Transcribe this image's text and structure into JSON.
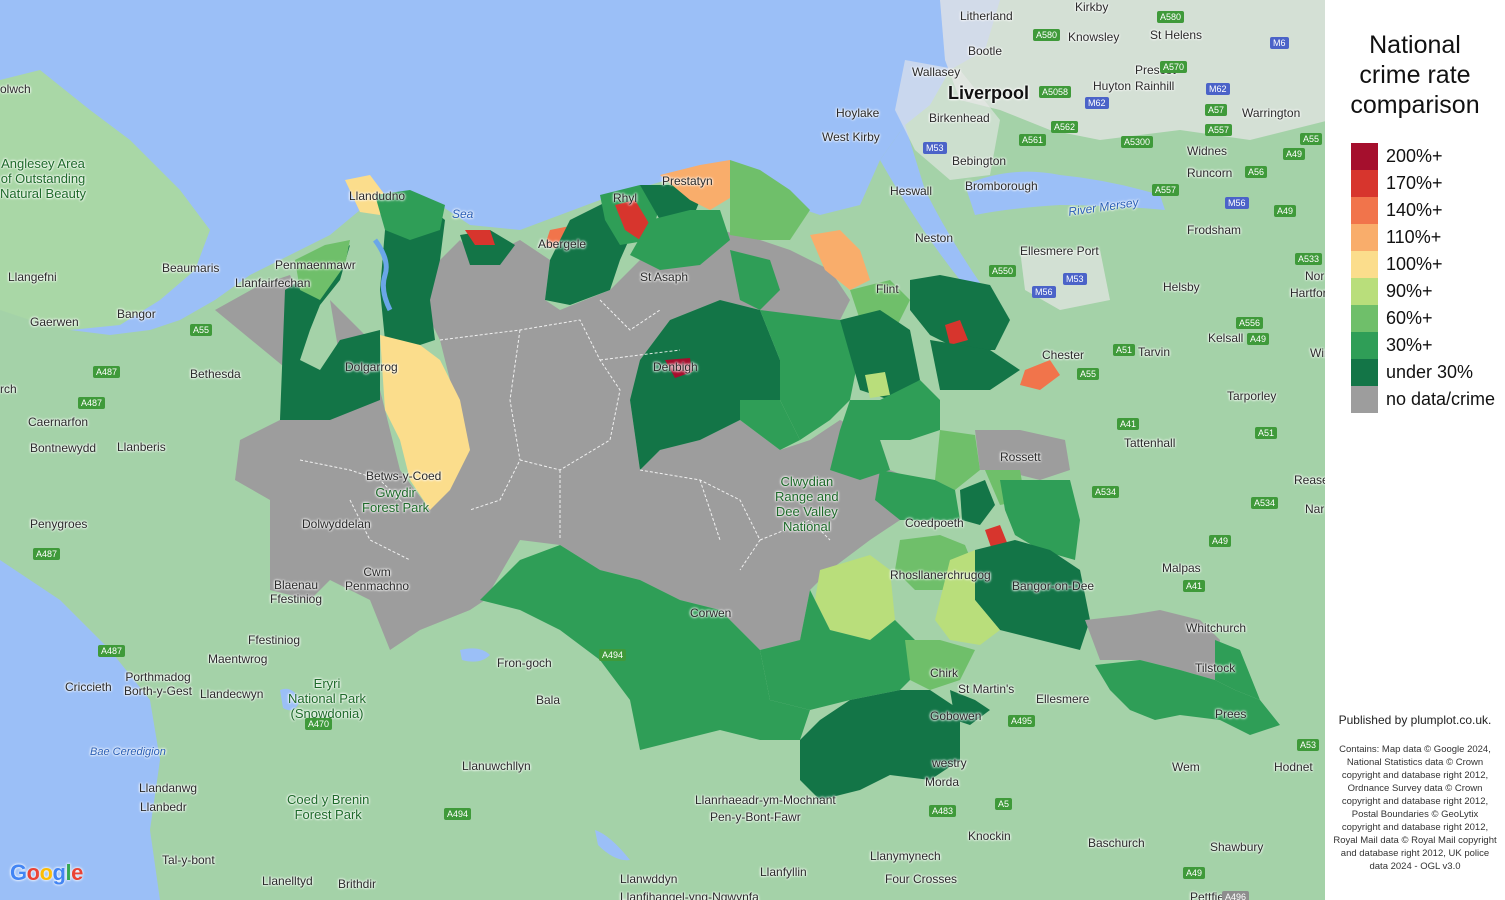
{
  "legend": {
    "title_lines": [
      "National",
      "crime rate",
      "comparison"
    ],
    "items": [
      {
        "label": "200%+",
        "color": "#a50f2d"
      },
      {
        "label": "170%+",
        "color": "#d7352d"
      },
      {
        "label": "140%+",
        "color": "#f1744b"
      },
      {
        "label": "110%+",
        "color": "#f9ad6b"
      },
      {
        "label": "100%+",
        "color": "#fbdd8c"
      },
      {
        "label": "90%+",
        "color": "#b9de7b"
      },
      {
        "label": "60%+",
        "color": "#6fbf6a"
      },
      {
        "label": "30%+",
        "color": "#2f9e57"
      },
      {
        "label": "under 30%",
        "color": "#137547"
      },
      {
        "label": "no data/crime",
        "color": "#9d9d9d"
      }
    ]
  },
  "published": "Published by plumplot.co.uk.",
  "attribution": "Contains: Map data © Google 2024, National Statistics data © Crown copyright and database right 2012, Ordnance Survey data © Crown copyright and database right 2012, Postal Boundaries © GeoLytix copyright and database right 2012, Royal Mail data © Royal Mail copyright and database right 2012, UK police data 2024 - OGL v3.0",
  "google_logo": "Google",
  "map": {
    "places": [
      {
        "id": "liverpool",
        "name": "Liverpool",
        "big": true
      },
      {
        "id": "litherland",
        "name": "Litherland"
      },
      {
        "id": "kirkby",
        "name": "Kirkby"
      },
      {
        "id": "knowsley",
        "name": "Knowsley"
      },
      {
        "id": "st-helens",
        "name": "St Helens"
      },
      {
        "id": "bootle",
        "name": "Bootle"
      },
      {
        "id": "wallasey",
        "name": "Wallasey"
      },
      {
        "id": "prescot",
        "name": "Prescot"
      },
      {
        "id": "huyton",
        "name": "Huyton"
      },
      {
        "id": "rainhill",
        "name": "Rainhill"
      },
      {
        "id": "warrington",
        "name": "Warrington"
      },
      {
        "id": "hoylake",
        "name": "Hoylake"
      },
      {
        "id": "birkenhead",
        "name": "Birkenhead"
      },
      {
        "id": "west-kirby",
        "name": "West Kirby"
      },
      {
        "id": "bebington",
        "name": "Bebington"
      },
      {
        "id": "widnes",
        "name": "Widnes"
      },
      {
        "id": "heswall",
        "name": "Heswall"
      },
      {
        "id": "bromborough",
        "name": "Bromborough"
      },
      {
        "id": "runcorn",
        "name": "Runcorn"
      },
      {
        "id": "frodsham",
        "name": "Frodsham"
      },
      {
        "id": "neston",
        "name": "Neston"
      },
      {
        "id": "ellesmere-port",
        "name": "Ellesmere Port"
      },
      {
        "id": "helsby",
        "name": "Helsby"
      },
      {
        "id": "chester",
        "name": "Chester"
      },
      {
        "id": "kelsall",
        "name": "Kelsall"
      },
      {
        "id": "tarvin",
        "name": "Tarvin"
      },
      {
        "id": "tarporley",
        "name": "Tarporley"
      },
      {
        "id": "tattenhall",
        "name": "Tattenhall"
      },
      {
        "id": "rossett",
        "name": "Rossett"
      },
      {
        "id": "malpas",
        "name": "Malpas"
      },
      {
        "id": "whitchurch",
        "name": "Whitchurch"
      },
      {
        "id": "ellesmere",
        "name": "Ellesmere"
      },
      {
        "id": "wem",
        "name": "Wem"
      },
      {
        "id": "hodnet",
        "name": "Hodnet"
      },
      {
        "id": "st-martins",
        "name": "St Martin's"
      },
      {
        "id": "oswestry",
        "name": "westry"
      },
      {
        "id": "morda",
        "name": "Morda"
      },
      {
        "id": "knockin",
        "name": "Knockin"
      },
      {
        "id": "baschurch",
        "name": "Baschurch"
      },
      {
        "id": "shawbury",
        "name": "Shawbury"
      },
      {
        "id": "llanymynech",
        "name": "Llanymynech"
      },
      {
        "id": "four-crosses",
        "name": "Four Crosses"
      },
      {
        "id": "llanfyllin",
        "name": "Llanfyllin"
      },
      {
        "id": "llanwddyn",
        "name": "Llanwddyn"
      },
      {
        "id": "llanrhaeadr",
        "name": "Llanrhaeadr-ym-Mochnant"
      },
      {
        "id": "pen-y-bont",
        "name": "Pen-y-Bont-Fawr"
      },
      {
        "id": "llanuwchllyn",
        "name": "Llanuwchllyn"
      },
      {
        "id": "bala",
        "name": "Bala"
      },
      {
        "id": "fron-goch",
        "name": "Fron-goch"
      },
      {
        "id": "blaenau",
        "name": "Blaenau\nFfestiniog"
      },
      {
        "id": "ffestiniog",
        "name": "Ffestiniog"
      },
      {
        "id": "maentwrog",
        "name": "Maentwrog"
      },
      {
        "id": "porthmadog",
        "name": "Porthmadog\nBorth-y-Gest"
      },
      {
        "id": "criccieth",
        "name": "Criccieth"
      },
      {
        "id": "llandecwyn",
        "name": "Llandecwyn"
      },
      {
        "id": "llandanwg",
        "name": "Llandanwg"
      },
      {
        "id": "llanbedr",
        "name": "Llanbedr"
      },
      {
        "id": "tal-y-bont",
        "name": "Tal-y-bont"
      },
      {
        "id": "llanelltyd",
        "name": "Llanelltyd"
      },
      {
        "id": "brithdir",
        "name": "Brithdir"
      },
      {
        "id": "penygroes",
        "name": "Penygroes"
      },
      {
        "id": "bontnewydd",
        "name": "Bontnewydd"
      },
      {
        "id": "caernarfon",
        "name": "Caernarfon"
      },
      {
        "id": "llanberis",
        "name": "Llanberis"
      },
      {
        "id": "bethesda",
        "name": "Bethesda"
      },
      {
        "id": "bangor",
        "name": "Bangor"
      },
      {
        "id": "gaerwen",
        "name": "Gaerwen"
      },
      {
        "id": "llangefni",
        "name": "Llangefni"
      },
      {
        "id": "beaumaris",
        "name": "Beaumaris"
      },
      {
        "id": "llanfairfechan",
        "name": "Llanfairfechan"
      },
      {
        "id": "penmaenmawr",
        "name": "Penmaenmawr"
      },
      {
        "id": "llandudno",
        "name": "Llandudno"
      },
      {
        "id": "dolgarrog",
        "name": "Dolgarrog"
      },
      {
        "id": "betws-y-coed",
        "name": "Betws-y-Coed"
      },
      {
        "id": "dolwyddelan",
        "name": "Dolwyddelan"
      },
      {
        "id": "cwm-penmachno",
        "name": "Cwm\nPenmachno"
      },
      {
        "id": "st-asaph",
        "name": "St Asaph"
      },
      {
        "id": "flint",
        "name": "Flint"
      },
      {
        "id": "coedpoeth",
        "name": "Coedpoeth"
      },
      {
        "id": "rhos",
        "name": "Rhosllanerchrugog"
      },
      {
        "id": "chirk",
        "name": "Chirk"
      },
      {
        "id": "gobowen",
        "name": "Gobowen"
      },
      {
        "id": "bangor-on-dee",
        "name": "Bangor-on-Dee"
      },
      {
        "id": "tilstock",
        "name": "Tilstock"
      },
      {
        "id": "prees",
        "name": "Prees"
      },
      {
        "id": "abergele",
        "name": "Abergele"
      },
      {
        "id": "rhyl",
        "name": "Rhyl"
      },
      {
        "id": "prestatyn",
        "name": "Prestatyn"
      },
      {
        "id": "denbigh",
        "name": "Denbigh"
      },
      {
        "id": "corwen",
        "name": "Corwen"
      },
      {
        "id": "anglesey-aonb",
        "name": "Anglesey Area\nof Outstanding\nNatural Beauty",
        "type": "park"
      },
      {
        "id": "eryri",
        "name": "Eryri\nNational Park\n(Snowdonia)",
        "type": "park"
      },
      {
        "id": "coed-y-brenin",
        "name": "Coed y Brenin\nForest Park",
        "type": "park"
      },
      {
        "id": "gwydir-forest",
        "name": "Gwydir\nForest Park",
        "type": "park"
      },
      {
        "id": "clwydian",
        "name": "Clwydian\nRange and\nDee Valley\nNational",
        "type": "park"
      },
      {
        "id": "river-mersey",
        "name": "River Mersey",
        "type": "water"
      },
      {
        "id": "bae-ceredigion",
        "name": "Bae Ceredigion",
        "type": "water"
      },
      {
        "id": "sea",
        "name": "Sea",
        "type": "water"
      },
      {
        "id": "holyhead-cut",
        "name": "olwch"
      },
      {
        "id": "rch",
        "name": "rch"
      },
      {
        "id": "rease",
        "name": "Rease"
      },
      {
        "id": "nar",
        "name": "Nar"
      },
      {
        "id": "hartford",
        "name": "Hartford"
      },
      {
        "id": "nor",
        "name": "Nor"
      },
      {
        "id": "win",
        "name": "Win"
      },
      {
        "id": "pettfield",
        "name": "Pettfield"
      },
      {
        "id": "llanfihangel",
        "name": "Llanfihangel-yng-Ngwynfa"
      }
    ],
    "roads": [
      {
        "id": "a580-1",
        "label": "A580",
        "style": "green"
      },
      {
        "id": "a580-2",
        "label": "A580",
        "style": "green"
      },
      {
        "id": "a570",
        "label": "A570",
        "style": "green"
      },
      {
        "id": "m6",
        "label": "M6",
        "style": "blue"
      },
      {
        "id": "a5058",
        "label": "A5058",
        "style": "green"
      },
      {
        "id": "m62-1",
        "label": "M62",
        "style": "blue"
      },
      {
        "id": "m62-2",
        "label": "M62",
        "style": "blue"
      },
      {
        "id": "a57",
        "label": "A57",
        "style": "green"
      },
      {
        "id": "a562",
        "label": "A562",
        "style": "green"
      },
      {
        "id": "a561",
        "label": "A561",
        "style": "green"
      },
      {
        "id": "a5300",
        "label": "A5300",
        "style": "green"
      },
      {
        "id": "a557-1",
        "label": "A557",
        "style": "green"
      },
      {
        "id": "a557-2",
        "label": "A557",
        "style": "green"
      },
      {
        "id": "m53-1",
        "label": "M53",
        "style": "blue"
      },
      {
        "id": "m53-2",
        "label": "M53",
        "style": "blue"
      },
      {
        "id": "m56-1",
        "label": "M56",
        "style": "blue"
      },
      {
        "id": "m56-2",
        "label": "M56",
        "style": "blue"
      },
      {
        "id": "a56",
        "label": "A56",
        "style": "green"
      },
      {
        "id": "a49-1",
        "label": "A49",
        "style": "green"
      },
      {
        "id": "a49-2",
        "label": "A49",
        "style": "green"
      },
      {
        "id": "a49-3",
        "label": "A49",
        "style": "green"
      },
      {
        "id": "a49-4",
        "label": "A49",
        "style": "green"
      },
      {
        "id": "a49-5",
        "label": "A49",
        "style": "green"
      },
      {
        "id": "a533",
        "label": "A533",
        "style": "green"
      },
      {
        "id": "a556",
        "label": "A556",
        "style": "green"
      },
      {
        "id": "a550",
        "label": "A550",
        "style": "green"
      },
      {
        "id": "a51-1",
        "label": "A51",
        "style": "green"
      },
      {
        "id": "a51-2",
        "label": "A51",
        "style": "green"
      },
      {
        "id": "a55-1",
        "label": "A55",
        "style": "green"
      },
      {
        "id": "a55-2",
        "label": "A55",
        "style": "green"
      },
      {
        "id": "a41-1",
        "label": "A41",
        "style": "green"
      },
      {
        "id": "a41-2",
        "label": "A41",
        "style": "green"
      },
      {
        "id": "a534-1",
        "label": "A534",
        "style": "green"
      },
      {
        "id": "a534-2",
        "label": "A534",
        "style": "green"
      },
      {
        "id": "a53",
        "label": "A53",
        "style": "green"
      },
      {
        "id": "a495",
        "label": "A495",
        "style": "green"
      },
      {
        "id": "a5",
        "label": "A5",
        "style": "green"
      },
      {
        "id": "a483",
        "label": "A483",
        "style": "green"
      },
      {
        "id": "a494-1",
        "label": "A494",
        "style": "green"
      },
      {
        "id": "a494-2",
        "label": "A494",
        "style": "green"
      },
      {
        "id": "a470",
        "label": "A470",
        "style": "green"
      },
      {
        "id": "a487-1",
        "label": "A487",
        "style": "green"
      },
      {
        "id": "a487-2",
        "label": "A487",
        "style": "green"
      },
      {
        "id": "a487-3",
        "label": "A487",
        "style": "green"
      },
      {
        "id": "a487-4",
        "label": "A487",
        "style": "green"
      },
      {
        "id": "a55-3",
        "label": "A55",
        "style": "green"
      },
      {
        "id": "a496",
        "label": "A496",
        "style": "green"
      }
    ]
  }
}
